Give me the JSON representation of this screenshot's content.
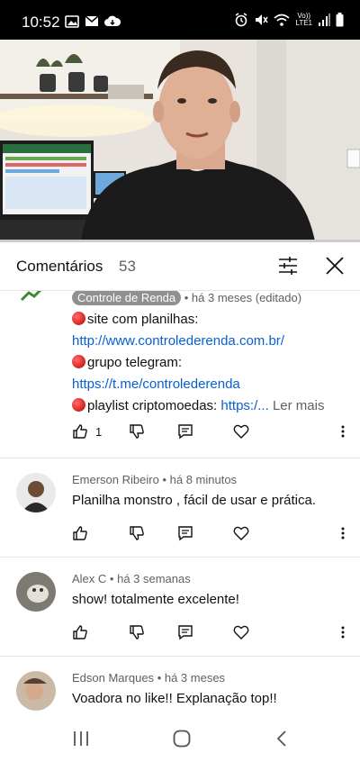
{
  "status_bar": {
    "time": "10:52",
    "left_icons": [
      "image-icon",
      "mail-icon",
      "cloud-icon"
    ],
    "right_icons": [
      "alarm-icon",
      "mute-icon",
      "wifi-icon",
      "signal-icon",
      "battery-icon"
    ],
    "network_label": "Vo))\nLTE1"
  },
  "video": {
    "progress": 0.0
  },
  "comments_header": {
    "title": "Comentários",
    "count": "53"
  },
  "comments": [
    {
      "author": "Controle de Renda",
      "time": "• há 3 meses (editado)",
      "lines": [
        {
          "dot": true,
          "text": "site com planilhas:"
        },
        {
          "link": "http://www.controlederenda.com.br/"
        },
        {
          "dot": true,
          "text": "grupo telegram:"
        },
        {
          "link": "https://t.me/controlederenda"
        },
        {
          "dot": true,
          "text": "playlist criptomoedas: ",
          "link": "https:/...",
          "more": "Ler mais"
        }
      ],
      "likes": "1"
    },
    {
      "author": "Emerson Ribeiro",
      "time": "• há 8 minutos",
      "text": "Planilha monstro , fácil de usar e prática.",
      "likes": ""
    },
    {
      "author": "Alex C",
      "time": "• há 3 semanas",
      "text": "show! totalmente excelente!",
      "likes": ""
    },
    {
      "author": "Edson Marques",
      "time": "• há 3 meses",
      "text": "Voadora no like!! Explanação top!!",
      "likes": ""
    }
  ],
  "colors": {
    "link": "#065fd4",
    "progress": "#ff0000",
    "muted": "#606060"
  }
}
